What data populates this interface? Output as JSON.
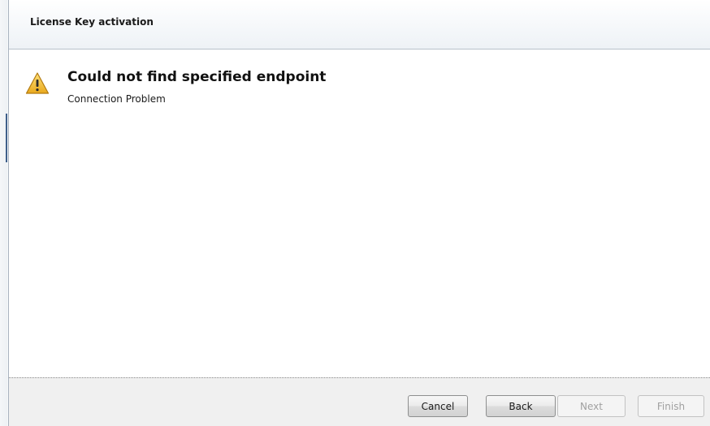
{
  "dialog": {
    "title": "License Key activation"
  },
  "message": {
    "icon": "warning-icon",
    "title": "Could not find specified endpoint",
    "subtitle": "Connection Problem"
  },
  "buttons": {
    "cancel": "Cancel",
    "back": "Back",
    "next": "Next",
    "finish": "Finish"
  },
  "colors": {
    "warning_fill": "#f5c342",
    "disabled_text": "#a0a0a0"
  }
}
